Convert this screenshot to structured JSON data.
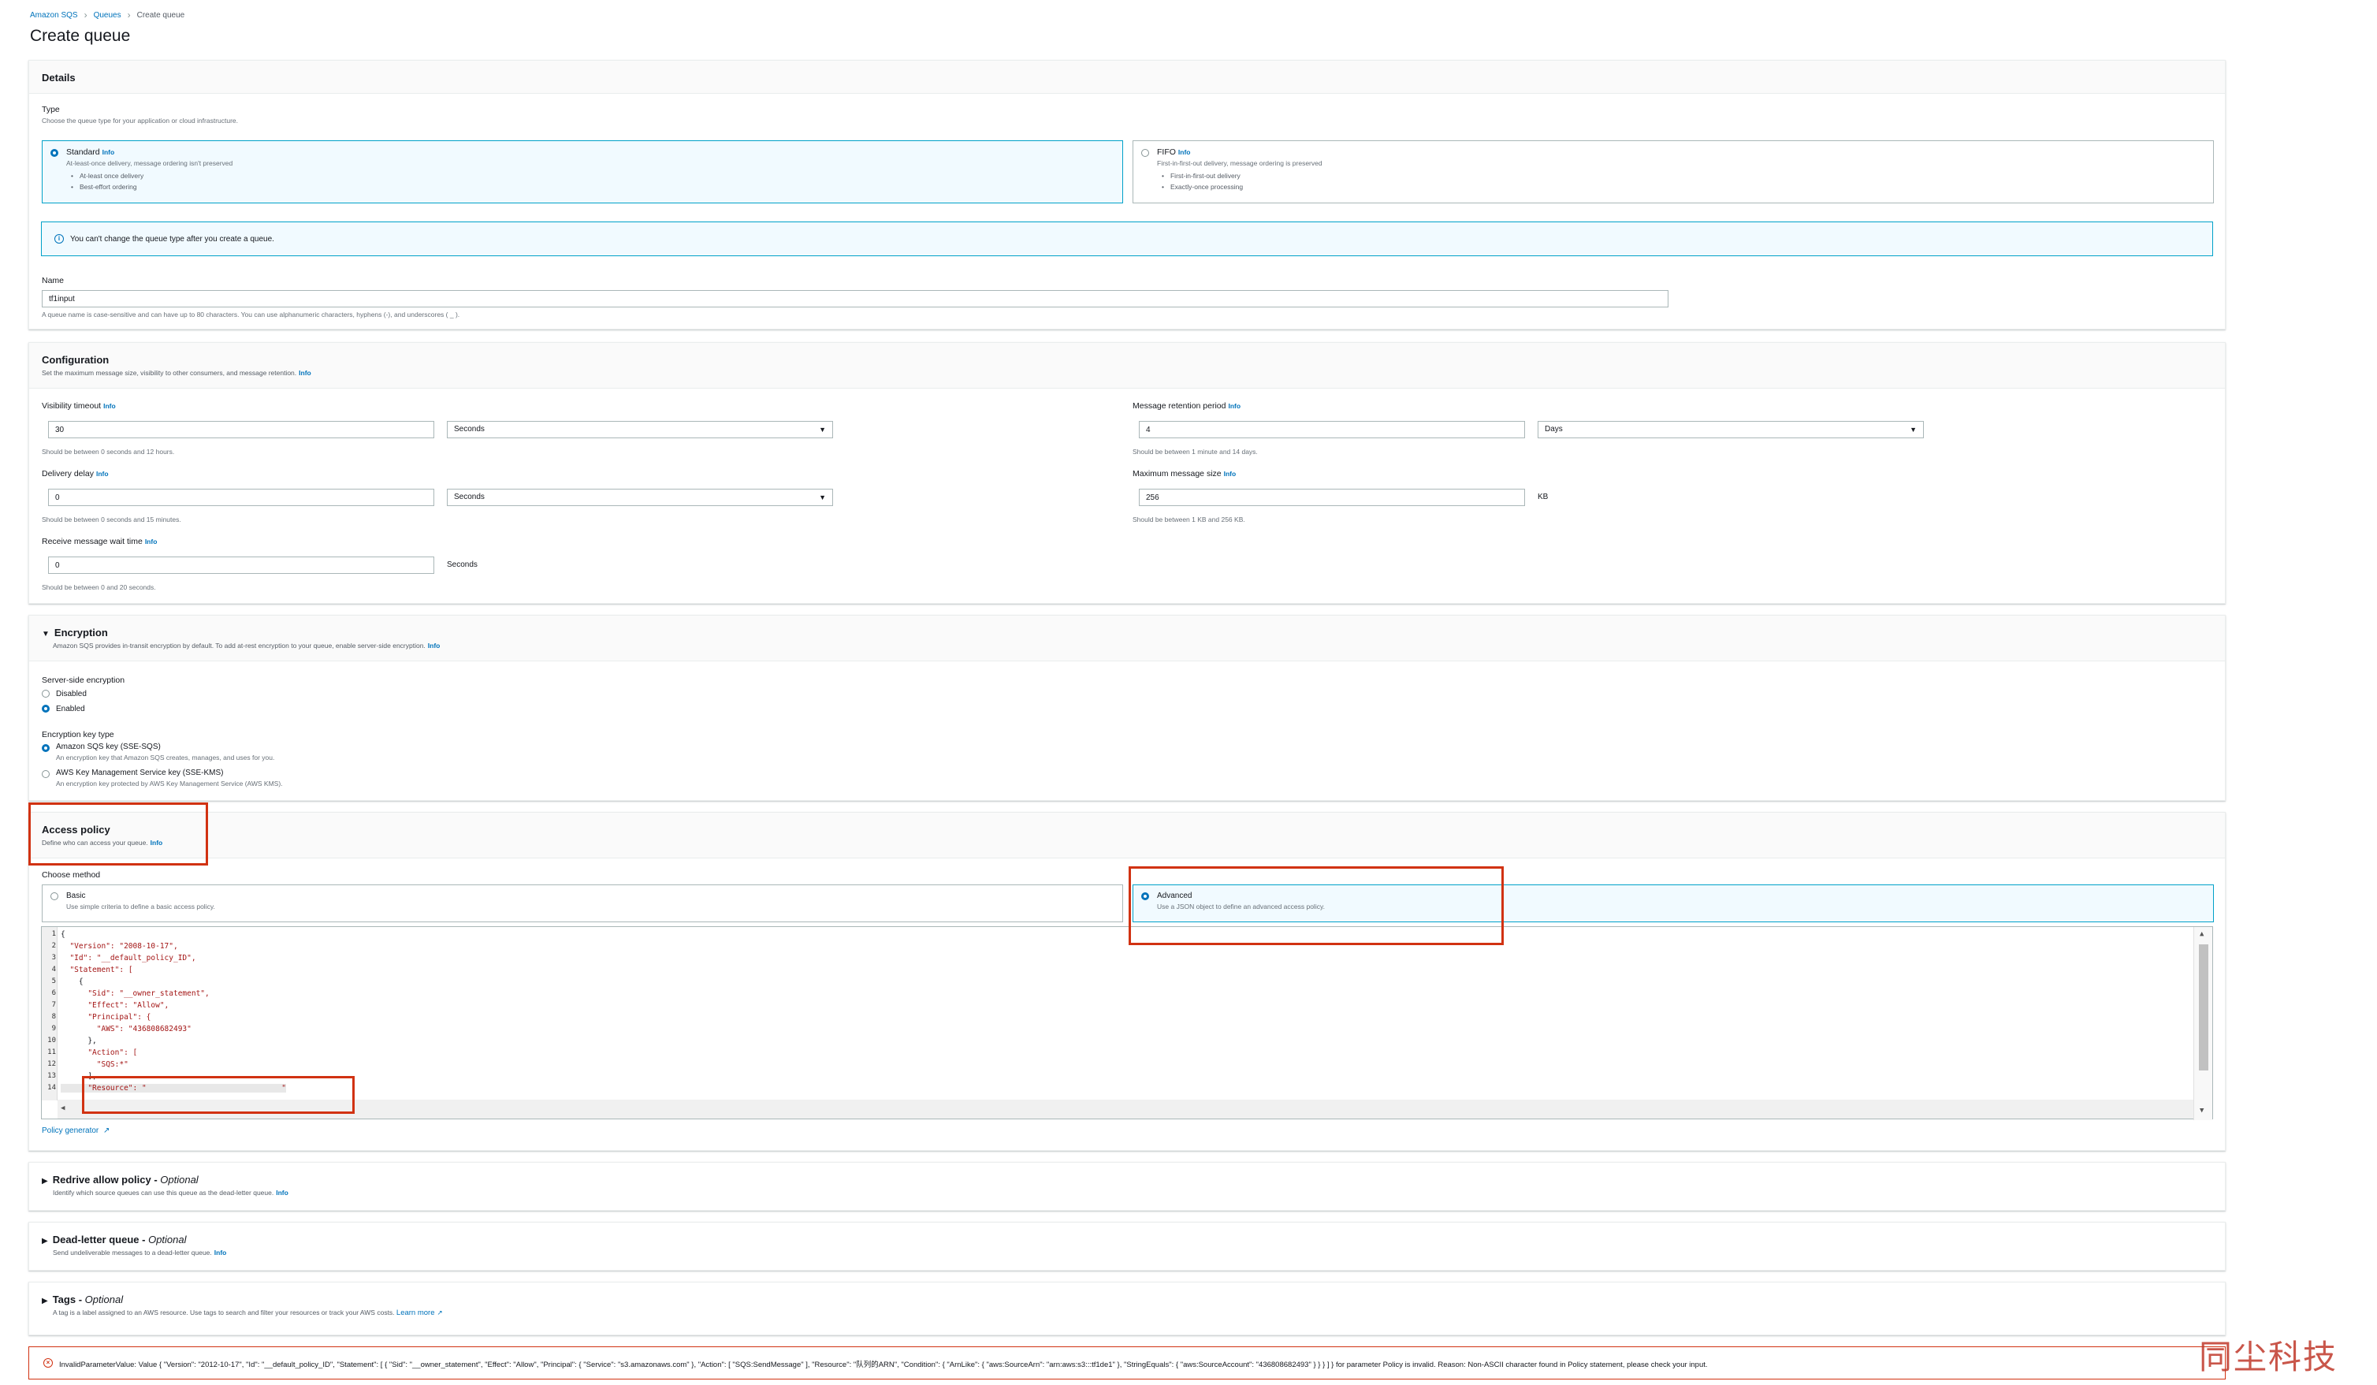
{
  "breadcrumb": [
    "Amazon SQS",
    "Queues",
    "Create queue"
  ],
  "page_title": "Create queue",
  "info_label": "Info",
  "details": {
    "title": "Details",
    "type_label": "Type",
    "type_desc": "Choose the queue type for your application or cloud infrastructure.",
    "standard": {
      "title": "Standard",
      "desc": "At-least-once delivery, message ordering isn't preserved",
      "bullets": [
        "At-least once delivery",
        "Best-effort ordering"
      ]
    },
    "fifo": {
      "title": "FIFO",
      "desc": "First-in-first-out delivery, message ordering is preserved",
      "bullets": [
        "First-in-first-out delivery",
        "Exactly-once processing"
      ]
    },
    "alert": "You can't change the queue type after you create a queue.",
    "name_label": "Name",
    "name_value": "tf1input",
    "name_hint": "A queue name is case-sensitive and can have up to 80 characters. You can use alphanumeric characters, hyphens (-), and underscores ( _ )."
  },
  "configuration": {
    "title": "Configuration",
    "desc": "Set the maximum message size, visibility to other consumers, and message retention.",
    "visibility": {
      "label": "Visibility timeout",
      "value": "30",
      "unit": "Seconds",
      "hint": "Should be between 0 seconds and 12 hours."
    },
    "retention": {
      "label": "Message retention period",
      "value": "4",
      "unit": "Days",
      "hint": "Should be between 1 minute and 14 days."
    },
    "delay": {
      "label": "Delivery delay",
      "value": "0",
      "unit": "Seconds",
      "hint": "Should be between 0 seconds and 15 minutes."
    },
    "max_size": {
      "label": "Maximum message size",
      "value": "256",
      "unit": "KB",
      "hint": "Should be between 1 KB and 256 KB."
    },
    "wait": {
      "label": "Receive message wait time",
      "value": "0",
      "unit": "Seconds",
      "hint": "Should be between 0 and 20 seconds."
    }
  },
  "encryption": {
    "title": "Encryption",
    "desc": "Amazon SQS provides in-transit encryption by default. To add at-rest encryption to your queue, enable server-side encryption.",
    "sse_label": "Server-side encryption",
    "disabled": "Disabled",
    "enabled": "Enabled",
    "key_type_label": "Encryption key type",
    "sqs_key": {
      "title": "Amazon SQS key (SSE-SQS)",
      "desc": "An encryption key that Amazon SQS creates, manages, and uses for you."
    },
    "kms_key": {
      "title": "AWS Key Management Service key (SSE-KMS)",
      "desc": "An encryption key protected by AWS Key Management Service (AWS KMS)."
    }
  },
  "access_policy": {
    "title": "Access policy",
    "desc": "Define who can access your queue.",
    "method_label": "Choose method",
    "basic": {
      "title": "Basic",
      "desc": "Use simple criteria to define a basic access policy."
    },
    "advanced": {
      "title": "Advanced",
      "desc": "Use a JSON object to define an advanced access policy."
    },
    "code_lines": [
      "{",
      "  \"Version\": \"2008-10-17\",",
      "  \"Id\": \"__default_policy_ID\",",
      "  \"Statement\": [",
      "    {",
      "      \"Sid\": \"__owner_statement\",",
      "      \"Effect\": \"Allow\",",
      "      \"Principal\": {",
      "        \"AWS\": \"436808682493\"",
      "      },",
      "      \"Action\": [",
      "        \"SQS:*\"",
      "      ],",
      "      \"Resource\": \"                              \""
    ],
    "policy_generator": "Policy generator"
  },
  "redrive": {
    "title": "Redrive allow policy",
    "optional": "Optional",
    "desc": "Identify which source queues can use this queue as the dead-letter queue."
  },
  "dead_letter": {
    "title": "Dead-letter queue",
    "optional": "Optional",
    "desc": "Send undeliverable messages to a dead-letter queue."
  },
  "tags": {
    "title": "Tags",
    "optional": "Optional",
    "desc": "A tag is a label assigned to an AWS resource. Use tags to search and filter your resources or track your AWS costs.",
    "learn_more": "Learn more"
  },
  "error": {
    "text": "InvalidParameterValue: Value { \"Version\": \"2012-10-17\", \"Id\": \"__default_policy_ID\", \"Statement\": [ { \"Sid\": \"__owner_statement\", \"Effect\": \"Allow\", \"Principal\": { \"Service\": \"s3.amazonaws.com\" }, \"Action\": [ \"SQS:SendMessage\" ], \"Resource\": \"队列的ARN\", \"Condition\": { \"ArnLike\": { \"aws:SourceArn\": \"arn:aws:s3:::tf1de1\" }, \"StringEquals\": { \"aws:SourceAccount\": \"436808682493\" } } } ] } for parameter Policy is invalid. Reason: Non-ASCII character found in Policy statement, please check your input."
  },
  "watermark": "同尘科技",
  "colors": {
    "accent": "#0073bb",
    "selected_border": "#00a1c9",
    "error": "#d13212",
    "highlight_box": "#d13212"
  }
}
